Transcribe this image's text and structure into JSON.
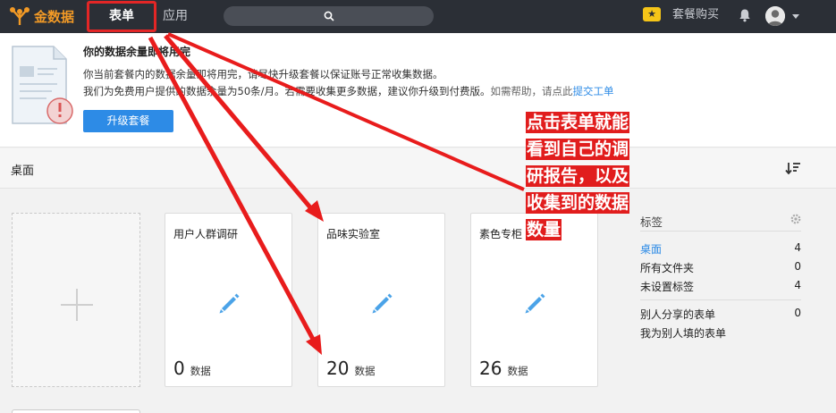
{
  "topbar": {
    "logo_text": "金数据",
    "nav": [
      {
        "label": "表单"
      },
      {
        "label": "应用"
      }
    ],
    "buy_label": "套餐购买",
    "colors": {
      "bg": "#2b2f36",
      "brand": "#f29a26",
      "highlight": "#e32626"
    }
  },
  "notice": {
    "title": "你的数据余量即将用完",
    "line1": "你当前套餐内的数据余量即将用完，请尽快升级套餐以保证账号正常收集数据。",
    "line2_main": "我们为免费用户提供的数据余量为50条/月。若需要收集更多数据，建议你升级到付费版。",
    "line2_help": "如需帮助，请点此",
    "line2_link": "提交工单",
    "upgrade_button": "升级套餐"
  },
  "desk": {
    "title": "桌面"
  },
  "cards": [
    {
      "title": "用户人群调研",
      "count": "0",
      "unit": "数据"
    },
    {
      "title": "品味实验室",
      "count": "20",
      "unit": "数据"
    },
    {
      "title": "素色专柜",
      "count": "26",
      "unit": "数据"
    }
  ],
  "sidebar": {
    "title": "标签",
    "items": [
      {
        "label": "桌面",
        "count": "4"
      },
      {
        "label": "所有文件夹",
        "count": "0"
      },
      {
        "label": "未设置标签",
        "count": "4"
      },
      {
        "label": "别人分享的表单",
        "count": "0"
      },
      {
        "label": "我为别人填的表单",
        "count": ""
      }
    ]
  },
  "annotation": {
    "lines": [
      "点击表单就能",
      "看到自己的调",
      "研报告，以及",
      "收集到的数据",
      "数量"
    ],
    "color": "#e11d1d"
  }
}
